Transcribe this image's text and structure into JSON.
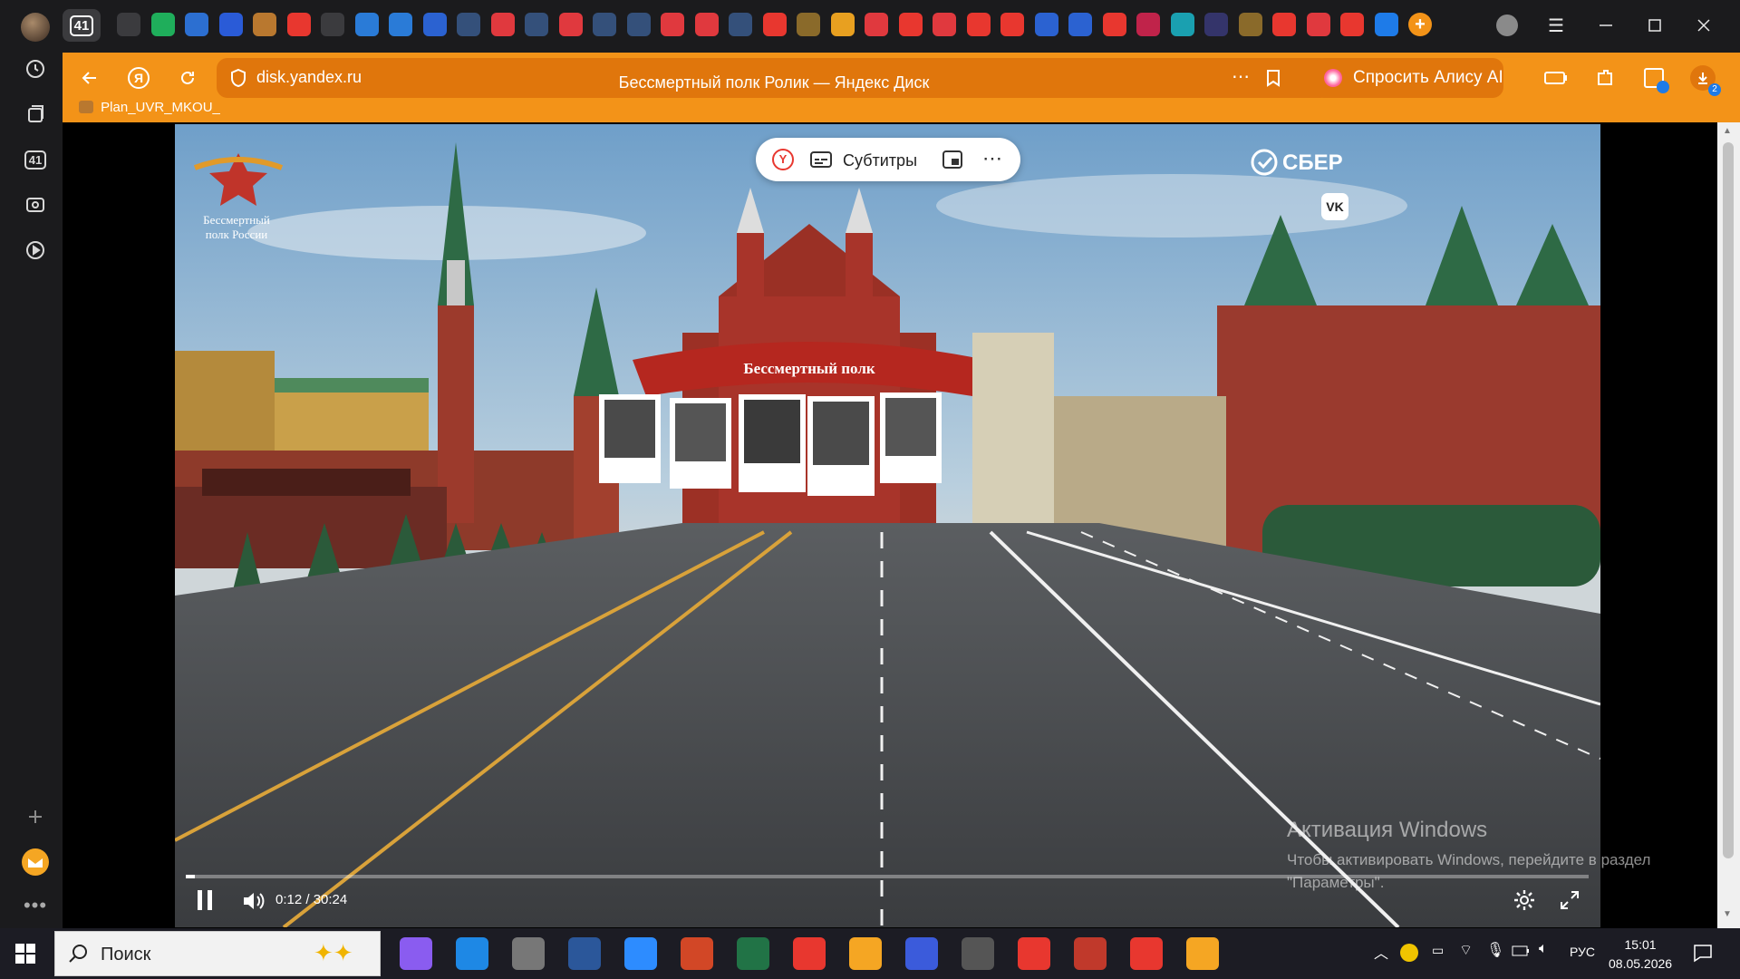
{
  "tabs": {
    "tab_count": "41",
    "favicons": [
      {
        "icon": "dropdown-icon",
        "color": "#3b3b3e"
      },
      {
        "icon": "gosuslugi-icon",
        "color": "#1fae5b"
      },
      {
        "icon": "car-icon",
        "color": "#2c6fd1"
      },
      {
        "icon": "edge-icon",
        "color": "#2a5bd7"
      },
      {
        "icon": "emblem-icon",
        "color": "#b9782f"
      },
      {
        "icon": "play-icon",
        "color": "#e8372f"
      },
      {
        "icon": "arrow-left-icon",
        "color": "#3b3b3e"
      },
      {
        "icon": "bar-icon",
        "color": "#2a7bd7"
      },
      {
        "icon": "window-icon",
        "color": "#2a7bd7"
      },
      {
        "icon": "flag-ru-icon",
        "color": "#2b62d1"
      },
      {
        "icon": "emblem-icon",
        "color": "#34507a"
      },
      {
        "icon": "pdf-icon",
        "color": "#e0393e"
      },
      {
        "icon": "emblem-icon",
        "color": "#34507a"
      },
      {
        "icon": "pdf-icon",
        "color": "#e0393e"
      },
      {
        "icon": "emblem-icon",
        "color": "#34507a"
      },
      {
        "icon": "emblem-icon",
        "color": "#34507a"
      },
      {
        "icon": "pdf-icon",
        "color": "#e0393e"
      },
      {
        "icon": "pdf-icon",
        "color": "#e0393e"
      },
      {
        "icon": "emblem-icon",
        "color": "#34507a"
      },
      {
        "icon": "yandex-icon",
        "color": "#e8372f"
      },
      {
        "icon": "emblem-icon",
        "color": "#8a6a2a"
      },
      {
        "icon": "mosaic-icon",
        "color": "#e8a020"
      },
      {
        "icon": "pdf-icon",
        "color": "#e0393e"
      },
      {
        "icon": "yandex-icon",
        "color": "#e8372f"
      },
      {
        "icon": "pdf-icon",
        "color": "#e0393e"
      },
      {
        "icon": "yandex-icon",
        "color": "#e8372f"
      },
      {
        "icon": "yandex-icon",
        "color": "#e8372f"
      },
      {
        "icon": "flag-ru-icon",
        "color": "#2b62d1"
      },
      {
        "icon": "flag-ru-icon",
        "color": "#2b62d1"
      },
      {
        "icon": "yandex-icon",
        "color": "#e8372f"
      },
      {
        "icon": "moscow-icon",
        "color": "#c0234a"
      },
      {
        "icon": "c-icon",
        "color": "#1aa0b0"
      },
      {
        "icon": "owl-icon",
        "color": "#34346a"
      },
      {
        "icon": "emblem-icon",
        "color": "#8a6a2a"
      },
      {
        "icon": "yandex-icon",
        "color": "#e8372f"
      },
      {
        "icon": "pdf-icon",
        "color": "#e0393e"
      },
      {
        "icon": "yandex-icon",
        "color": "#e8372f"
      },
      {
        "icon": "disk-icon",
        "color": "#1e7be8"
      }
    ],
    "window_controls": {
      "profile": "profile-icon",
      "menu": "menu-icon",
      "minimize": "minimize-icon",
      "maximize": "maximize-icon",
      "close": "close-icon"
    }
  },
  "addressbar": {
    "url": "disk.yandex.ru",
    "title": "Бессмертный полк Ролик — Яндекс Диск",
    "alice_label": "Спросить Алису AI",
    "downloads_badge": "2",
    "bookmark": "Plan_UVR_MKOU_"
  },
  "sidebar": {
    "items": [
      {
        "icon": "history-icon"
      },
      {
        "icon": "collections-icon"
      },
      {
        "icon": "tab-count-icon",
        "label": "41"
      },
      {
        "icon": "screenshot-icon"
      },
      {
        "icon": "video-icon"
      }
    ],
    "bottom": [
      {
        "icon": "add-icon"
      },
      {
        "icon": "mail-icon"
      },
      {
        "icon": "more-icon"
      }
    ]
  },
  "video": {
    "toolbar_subtitles": "Субтитры",
    "time": "0:12 / 30:24",
    "progress_fraction": 0.0066,
    "logo_text_line1": "Бессмертный",
    "logo_text_line2": "полк России",
    "sber_logo": "СБЕР",
    "banner_text": "Бессмертный полк"
  },
  "activation": {
    "title": "Активация Windows",
    "line": "Чтобы активировать Windows, перейдите в раздел \"Параметры\"."
  },
  "taskbar": {
    "search_placeholder": "Поиск",
    "apps": [
      "alice-app-icon",
      "edge-app-icon",
      "mic-app-icon",
      "word-app-icon",
      "zoom-app-icon",
      "presentation-app-icon",
      "excel-app-icon",
      "yandex-app-icon",
      "music-app-icon",
      "copy-app-icon",
      "voice-app-icon",
      "opera-app-icon",
      "opera-gx-app-icon",
      "yandex-browser-app-icon",
      "mail-app-icon"
    ],
    "lang": "РУС",
    "time": "15:01",
    "date": "08.05.2026"
  }
}
